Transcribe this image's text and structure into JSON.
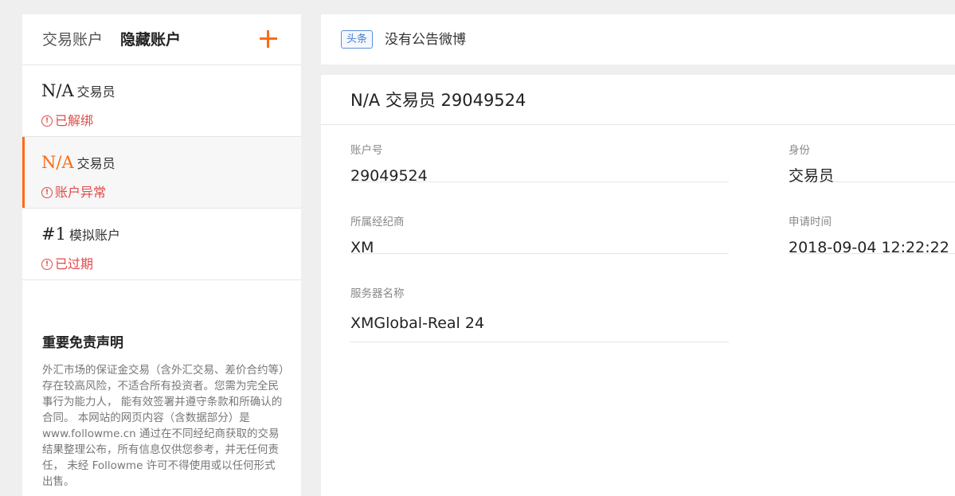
{
  "sidebar": {
    "tabs": {
      "trading": "交易账户",
      "hidden": "隐藏账户"
    },
    "accounts": [
      {
        "name": "N/A",
        "type": "交易员",
        "status": "已解绑",
        "active": false
      },
      {
        "name": "N/A",
        "type": "交易员",
        "status": "账户异常",
        "active": true
      },
      {
        "name": "#1",
        "type": "模拟账户",
        "status": "已过期",
        "active": false
      }
    ],
    "disclaimer": {
      "title": "重要免责声明",
      "text": "外汇市场的保证金交易（含外汇交易、差价合约等）存在较高风险，不适合所有投资者。您需为完全民事行为能力人， 能有效签署并遵守条款和所确认的合同。 本网站的网页内容（含数据部分）是 www.followme.cn 通过在不同经纪商获取的交易结果整理公布，所有信息仅供您参考，并无任何责任， 未经 Followme 许可不得使用或以任何形式出售。"
    }
  },
  "news": {
    "badge": "头条",
    "text": "没有公告微博"
  },
  "detail": {
    "title": "N/A 交易员 29049524",
    "fields": {
      "account_no": {
        "label": "账户号",
        "value": "29049524"
      },
      "identity": {
        "label": "身份",
        "value": "交易员"
      },
      "broker": {
        "label": "所属经纪商",
        "value": "XM"
      },
      "apply_time": {
        "label": "申请时间",
        "value": "2018-09-04 12:22:22"
      },
      "server": {
        "label": "服务器名称",
        "value": "XMGlobal-Real 24"
      }
    }
  },
  "colors": {
    "accent": "#ff6a13",
    "status_error": "#e04a4a",
    "badge_blue": "#4a7fcb"
  }
}
